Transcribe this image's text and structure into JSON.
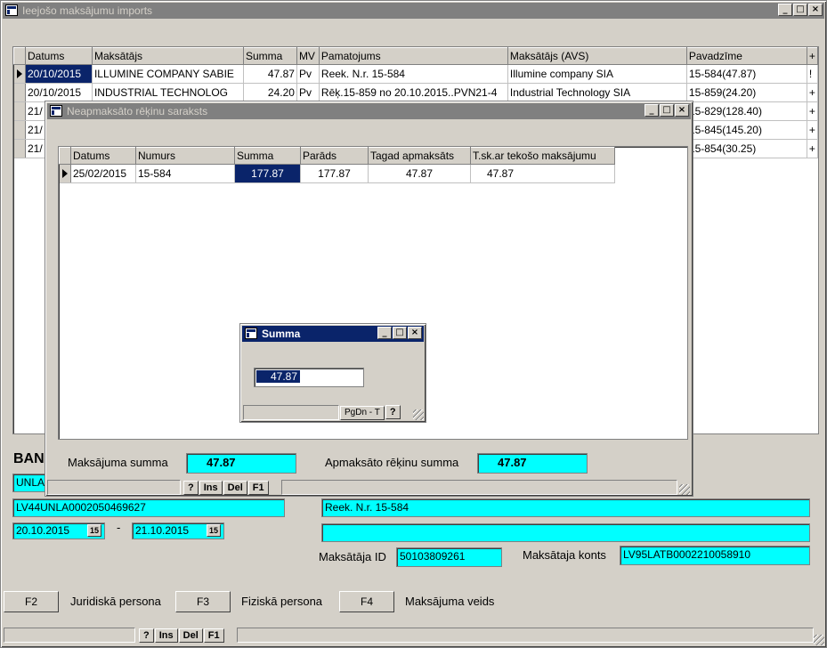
{
  "main": {
    "title": "Ieejošo maksājumu imports",
    "columns": [
      "Datums",
      "Maksātājs",
      "Summa",
      "MV",
      "Pamatojums",
      "Maksātājs (AVS)",
      "Pavadzīme",
      "+"
    ],
    "rows": [
      {
        "date": "20/10/2015",
        "payer": "ILLUMINE COMPANY SABIE",
        "sum": "47.87",
        "mv": "Pv",
        "reason": "Reek. N.r. 15-584",
        "payer_avs": "Illumine company SIA",
        "invoice": "15-584(47.87)",
        "flag": "!"
      },
      {
        "date": "20/10/2015",
        "payer": "INDUSTRIAL TECHNOLOG",
        "sum": "24.20",
        "mv": "Pv",
        "reason": "Rēķ.15-859 no 20.10.2015..PVN21-4",
        "payer_avs": "Industrial Technology SIA",
        "invoice": "15-859(24.20)",
        "flag": "+"
      },
      {
        "date": "21/",
        "payer": "",
        "sum": "",
        "mv": "",
        "reason": "",
        "payer_avs": "",
        "invoice": "15-829(128.40)",
        "flag": "+"
      },
      {
        "date": "21/",
        "payer": "",
        "sum": "",
        "mv": "",
        "reason": "",
        "payer_avs": "",
        "invoice": "15-845(145.20)",
        "flag": "+"
      },
      {
        "date": "21/",
        "payer": "",
        "sum": "",
        "mv": "",
        "reason": "",
        "payer_avs": "",
        "invoice": "15-854(30.25)",
        "flag": "+"
      }
    ],
    "bank_label": "BAN",
    "bank_field": "UNLA",
    "account_field": "LV44UNLA0002050469627",
    "reason_field": "Reek. N.r. 15-584",
    "reason_field2": "",
    "date_from": "20.10.2015",
    "date_to": "21.10.2015",
    "date_dash": "-",
    "calendar_glyph": "15",
    "payer_id_label": "Maksātāja ID",
    "payer_id": "50103809261",
    "payer_acc_label": "Maksātaja konts",
    "payer_acc": "LV95LATB0002210058910",
    "fkeys": [
      {
        "key": "F2",
        "label": "Juridiskā persona"
      },
      {
        "key": "F3",
        "label": "Fiziskā persona"
      },
      {
        "key": "F4",
        "label": "Maksājuma veids"
      }
    ],
    "status_buttons": [
      "?",
      "Ins",
      "Del",
      "F1"
    ]
  },
  "unpaid": {
    "title": "Neapmaksāto rēķinu saraksts",
    "columns": [
      "Datums",
      "Numurs",
      "Summa",
      "Parāds",
      "Tagad apmaksāts",
      "T.sk.ar tekošo maksājumu"
    ],
    "rows": [
      {
        "date": "25/02/2015",
        "number": "15-584",
        "sum": "177.87",
        "debt": "177.87",
        "paid_now": "47.87",
        "incl_current": "47.87"
      }
    ],
    "payment_sum_label": "Maksājuma summa",
    "payment_sum": "47.87",
    "paid_sum_label": "Apmaksāto rēķinu summa",
    "paid_sum": "47.87",
    "status_buttons": [
      "?",
      "Ins",
      "Del",
      "F1"
    ]
  },
  "sum_dialog": {
    "title": "Summa",
    "value": "47.87",
    "status_hint": "PgDn - T",
    "help_button": "?"
  },
  "window_controls": {
    "minimize": "_",
    "maximize": "□",
    "close": "×"
  }
}
